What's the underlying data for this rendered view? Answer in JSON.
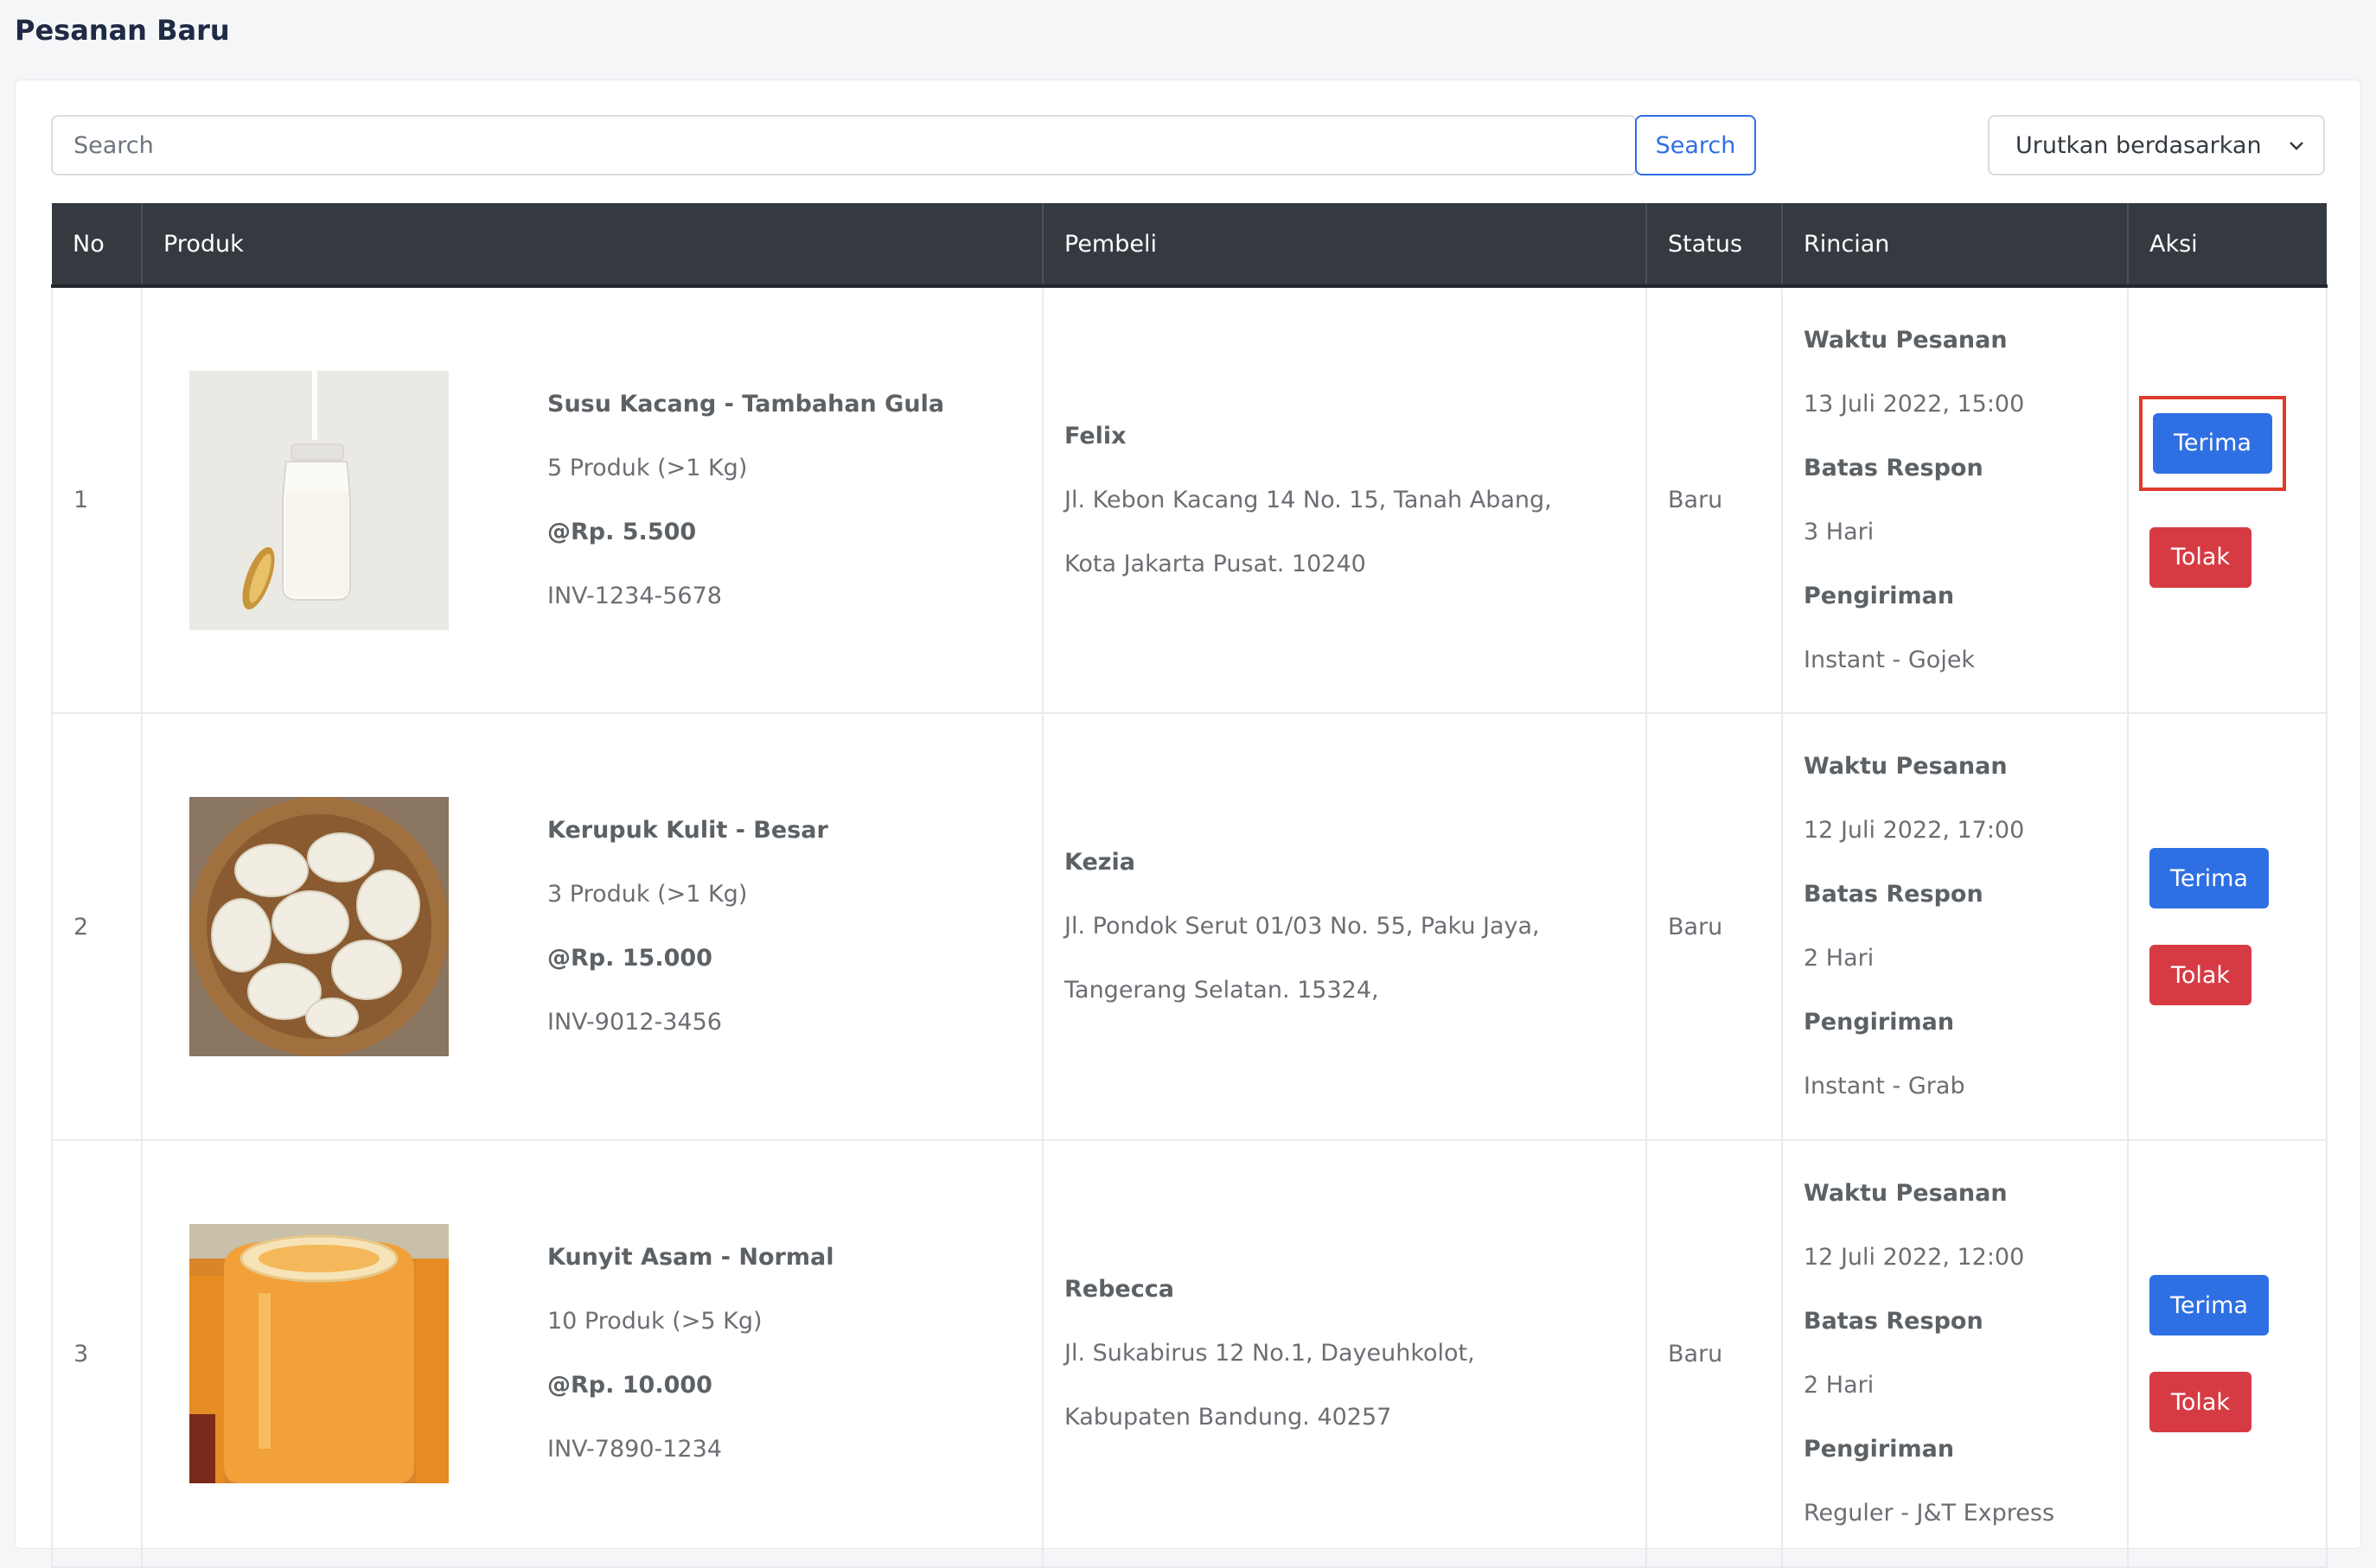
{
  "page": {
    "title": "Pesanan Baru"
  },
  "toolbar": {
    "search_placeholder": "Search",
    "search_button": "Search",
    "sort_label": "Urutkan berdasarkan"
  },
  "table": {
    "headers": [
      "No",
      "Produk",
      "Pembeli",
      "Status",
      "Rincian",
      "Aksi"
    ],
    "labels": {
      "waktu": "Waktu Pesanan",
      "batas": "Batas Respon",
      "pengiriman": "Pengiriman",
      "terima": "Terima",
      "tolak": "Tolak"
    },
    "rows": [
      {
        "no": "1",
        "product_name": "Susu Kacang - Tambahan Gula",
        "qty": "5 Produk (>1 Kg)",
        "price": "@Rp. 5.500",
        "invoice": "INV-1234-5678",
        "buyer_name": "Felix",
        "address_line1": "Jl. Kebon Kacang 14 No. 15, Tanah Abang,",
        "address_line2": "Kota Jakarta Pusat. 10240",
        "status": "Baru",
        "waktu": "13 Juli 2022, 15:00",
        "batas": "3 Hari",
        "pengiriman": "Instant - Gojek"
      },
      {
        "no": "2",
        "product_name": "Kerupuk Kulit - Besar",
        "qty": "3 Produk (>1 Kg)",
        "price": "@Rp. 15.000",
        "invoice": "INV-9012-3456",
        "buyer_name": "Kezia",
        "address_line1": "Jl. Pondok Serut 01/03 No. 55, Paku Jaya,",
        "address_line2": "Tangerang Selatan. 15324,",
        "status": "Baru",
        "waktu": "12 Juli 2022, 17:00",
        "batas": "2 Hari",
        "pengiriman": "Instant - Grab"
      },
      {
        "no": "3",
        "product_name": "Kunyit Asam - Normal",
        "qty": "10 Produk (>5 Kg)",
        "price": "@Rp. 10.000",
        "invoice": "INV-7890-1234",
        "buyer_name": "Rebecca",
        "address_line1": "Jl. Sukabirus 12 No.1, Dayeuhkolot,",
        "address_line2": "Kabupaten Bandung. 40257",
        "status": "Baru",
        "waktu": "12 Juli 2022, 12:00",
        "batas": "2 Hari",
        "pengiriman": "Reguler - J&T Express"
      }
    ]
  },
  "colors": {
    "primary": "#2f6fe4",
    "danger": "#d63b44",
    "header_bg": "#343a40",
    "highlight": "#e03b2b"
  }
}
